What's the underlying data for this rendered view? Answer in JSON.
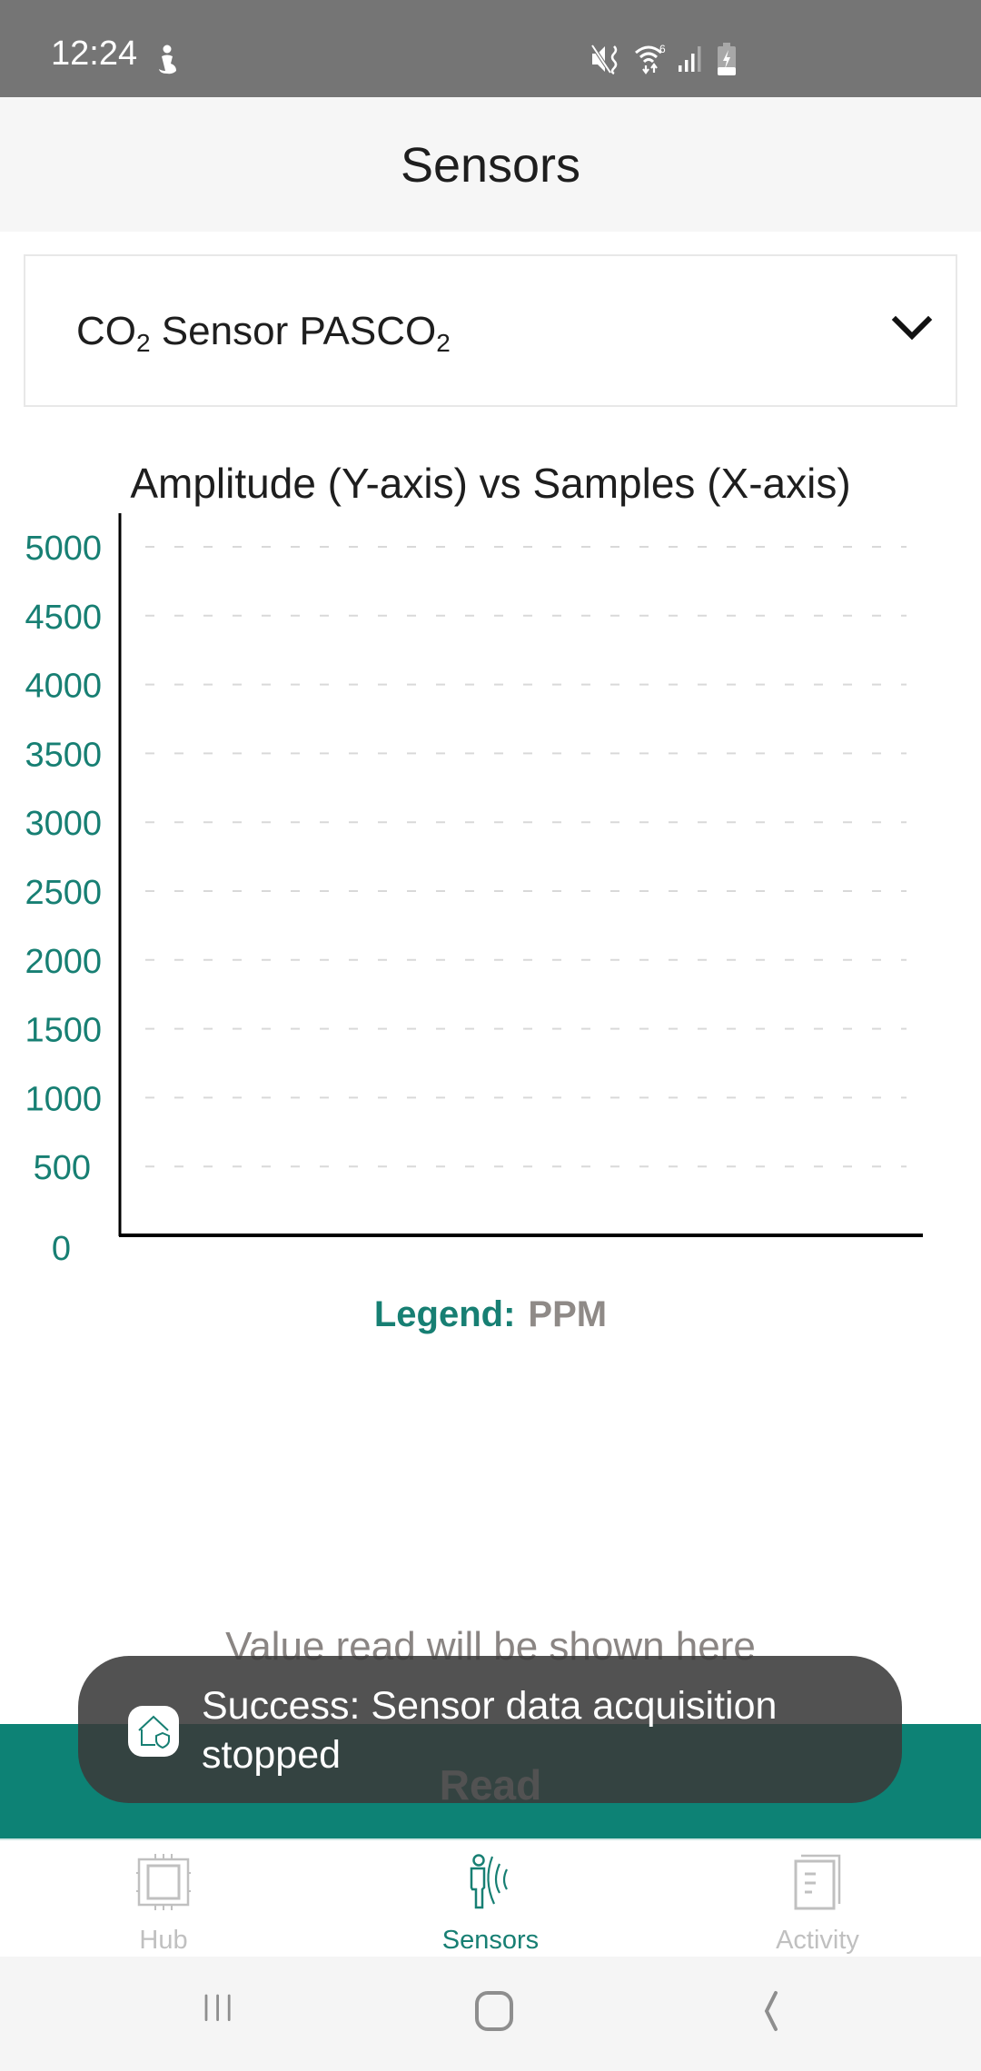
{
  "status_bar": {
    "time": "12:24",
    "icons": [
      "accessibility-icon",
      "mute-vibrate-icon",
      "wifi-6-icon",
      "signal-icon",
      "battery-charging-icon"
    ]
  },
  "header": {
    "title": "Sensors"
  },
  "sensor_select": {
    "selected_value": "CO₂ Sensor PASCO₂",
    "parts": {
      "prefix": "CO",
      "sub1": "2",
      "middle": " Sensor PASCO",
      "sub2": "2"
    },
    "icon": "chevron-down-icon"
  },
  "chart_data": {
    "type": "line",
    "title": "Amplitude (Y-axis) vs Samples (X-axis)",
    "xlabel": "Samples",
    "ylabel": "Amplitude",
    "ylim": [
      0,
      5000
    ],
    "yticks": [
      0,
      500,
      1000,
      1500,
      2000,
      2500,
      3000,
      3500,
      4000,
      4500,
      5000
    ],
    "ytick_labels": [
      "0",
      "500",
      "1000",
      "1500",
      "2000",
      "2500",
      "3000",
      "3500",
      "4000",
      "4500",
      "5000"
    ],
    "grid": "horizontal-dashed",
    "series": [
      {
        "name": "PPM",
        "values": []
      }
    ],
    "legend": {
      "label": "Legend:",
      "entries": [
        "PPM"
      ],
      "placement": "bottom"
    },
    "colors": {
      "tick_labels": "#177f73",
      "grid": "#d9d9d9",
      "axis": "#000000"
    }
  },
  "legend": {
    "label": "Legend:",
    "value": "PPM"
  },
  "value_placeholder": "Value read will be shown here",
  "read_button": {
    "label": "Read",
    "color": "#0d8275"
  },
  "toast": {
    "message": "Success: Sensor data acquisition stopped",
    "icon": "home-shield-icon"
  },
  "bottom_nav": {
    "items": [
      {
        "label": "Hub",
        "icon": "chip-icon",
        "active": false
      },
      {
        "label": "Sensors",
        "icon": "person-sensor-icon",
        "active": true
      },
      {
        "label": "Activity",
        "icon": "documents-icon",
        "active": false
      }
    ],
    "active_color": "#177f73",
    "inactive_color": "#c0c0c0"
  },
  "system_nav": {
    "buttons": [
      "recent-apps-icon",
      "home-icon",
      "back-icon"
    ]
  }
}
